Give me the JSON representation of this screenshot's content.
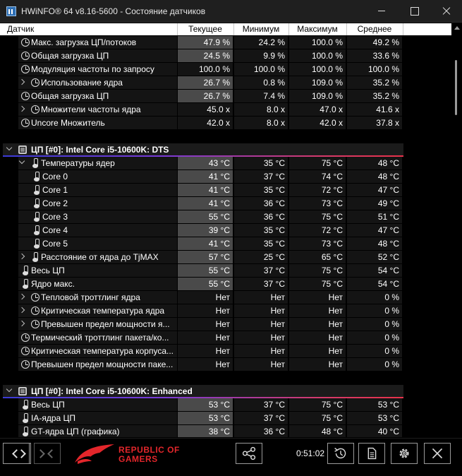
{
  "window": {
    "title": "HWiNFO® 64 v8.16-5600 - Состояние датчиков"
  },
  "columns": {
    "sensor": "Датчик",
    "current": "Текущее",
    "min": "Минимум",
    "max": "Максимум",
    "avg": "Среднее"
  },
  "rows": [
    {
      "kind": "item",
      "indent": 1,
      "expand": "",
      "icon": "clock-icon",
      "name": "Макс. загрузка ЦП/потоков",
      "cur": "47.9 %",
      "min": "24.2 %",
      "max": "100.0 %",
      "avg": "49.2 %",
      "hl": true
    },
    {
      "kind": "item",
      "indent": 1,
      "expand": "",
      "icon": "clock-icon",
      "name": "Общая загрузка ЦП",
      "cur": "24.5 %",
      "min": "9.9 %",
      "max": "100.0 %",
      "avg": "33.6 %",
      "hl": true
    },
    {
      "kind": "item",
      "indent": 1,
      "expand": "",
      "icon": "clock-icon",
      "name": "Модуляция частоты по запросу",
      "cur": "100.0 %",
      "min": "100.0 %",
      "max": "100.0 %",
      "avg": "100.0 %",
      "hl": false
    },
    {
      "kind": "item",
      "indent": 2,
      "expand": "right",
      "icon": "clock-icon",
      "name": "Использование ядра",
      "cur": "26.7 %",
      "min": "0.8 %",
      "max": "109.0 %",
      "avg": "35.2 %",
      "hl": true
    },
    {
      "kind": "item",
      "indent": 1,
      "expand": "",
      "icon": "clock-icon",
      "name": "Общая загрузка ЦП",
      "cur": "26.7 %",
      "min": "7.4 %",
      "max": "109.0 %",
      "avg": "35.2 %",
      "hl": true
    },
    {
      "kind": "item",
      "indent": 2,
      "expand": "right",
      "icon": "clock-icon",
      "name": "Множители частоты ядра",
      "cur": "45.0 x",
      "min": "8.0 x",
      "max": "47.0 x",
      "avg": "41.6 x",
      "hl": false
    },
    {
      "kind": "item",
      "indent": 1,
      "expand": "",
      "icon": "clock-icon",
      "name": "Uncore Множитель",
      "cur": "42.0 x",
      "min": "8.0 x",
      "max": "42.0 x",
      "avg": "37.8 x",
      "hl": false
    },
    {
      "kind": "blank"
    },
    {
      "kind": "group",
      "name": "ЦП [#0]: Intel Core i5-10600K: DTS"
    },
    {
      "kind": "item",
      "indent": 2,
      "expand": "down",
      "icon": "thermometer-icon",
      "name": "Температуры ядер",
      "cur": "43 °C",
      "min": "35 °C",
      "max": "75 °C",
      "avg": "48 °C",
      "hl": true
    },
    {
      "kind": "item",
      "indent": 3,
      "expand": "",
      "icon": "thermometer-icon",
      "name": "Core 0",
      "cur": "41 °C",
      "min": "37 °C",
      "max": "74 °C",
      "avg": "48 °C",
      "hl": true
    },
    {
      "kind": "item",
      "indent": 3,
      "expand": "",
      "icon": "thermometer-icon",
      "name": "Core 1",
      "cur": "41 °C",
      "min": "35 °C",
      "max": "72 °C",
      "avg": "47 °C",
      "hl": true
    },
    {
      "kind": "item",
      "indent": 3,
      "expand": "",
      "icon": "thermometer-icon",
      "name": "Core 2",
      "cur": "41 °C",
      "min": "36 °C",
      "max": "73 °C",
      "avg": "49 °C",
      "hl": true
    },
    {
      "kind": "item",
      "indent": 3,
      "expand": "",
      "icon": "thermometer-icon",
      "name": "Core 3",
      "cur": "55 °C",
      "min": "36 °C",
      "max": "75 °C",
      "avg": "51 °C",
      "hl": true
    },
    {
      "kind": "item",
      "indent": 3,
      "expand": "",
      "icon": "thermometer-icon",
      "name": "Core 4",
      "cur": "39 °C",
      "min": "35 °C",
      "max": "72 °C",
      "avg": "47 °C",
      "hl": true
    },
    {
      "kind": "item",
      "indent": 3,
      "expand": "",
      "icon": "thermometer-icon",
      "name": "Core 5",
      "cur": "41 °C",
      "min": "35 °C",
      "max": "73 °C",
      "avg": "48 °C",
      "hl": true
    },
    {
      "kind": "item",
      "indent": 2,
      "expand": "right",
      "icon": "thermometer-icon",
      "name": "Расстояние от ядра до TjMAX",
      "cur": "57 °C",
      "min": "25 °C",
      "max": "65 °C",
      "avg": "52 °C",
      "hl": true
    },
    {
      "kind": "item",
      "indent": 1,
      "expand": "",
      "icon": "thermometer-icon",
      "name": "Весь ЦП",
      "cur": "55 °C",
      "min": "37 °C",
      "max": "75 °C",
      "avg": "54 °C",
      "hl": true
    },
    {
      "kind": "item",
      "indent": 1,
      "expand": "",
      "icon": "thermometer-icon",
      "name": "Ядро макс.",
      "cur": "55 °C",
      "min": "37 °C",
      "max": "75 °C",
      "avg": "54 °C",
      "hl": true
    },
    {
      "kind": "item",
      "indent": 2,
      "expand": "right",
      "icon": "clock-icon",
      "name": "Тепловой троттлинг ядра",
      "cur": "Нет",
      "min": "Нет",
      "max": "Нет",
      "avg": "0 %",
      "hl": false
    },
    {
      "kind": "item",
      "indent": 2,
      "expand": "right",
      "icon": "clock-icon",
      "name": "Критическая температура ядра",
      "cur": "Нет",
      "min": "Нет",
      "max": "Нет",
      "avg": "0 %",
      "hl": false
    },
    {
      "kind": "item",
      "indent": 2,
      "expand": "right",
      "icon": "clock-icon",
      "name": "Превышен предел мощности я...",
      "cur": "Нет",
      "min": "Нет",
      "max": "Нет",
      "avg": "0 %",
      "hl": false
    },
    {
      "kind": "item",
      "indent": 1,
      "expand": "",
      "icon": "clock-icon",
      "name": "Термический троттлинг пакета/ко...",
      "cur": "Нет",
      "min": "Нет",
      "max": "Нет",
      "avg": "0 %",
      "hl": false
    },
    {
      "kind": "item",
      "indent": 1,
      "expand": "",
      "icon": "clock-icon",
      "name": "Критическая температура корпуса...",
      "cur": "Нет",
      "min": "Нет",
      "max": "Нет",
      "avg": "0 %",
      "hl": false
    },
    {
      "kind": "item",
      "indent": 1,
      "expand": "",
      "icon": "clock-icon",
      "name": "Превышен предел мощности паке...",
      "cur": "Нет",
      "min": "Нет",
      "max": "Нет",
      "avg": "0 %",
      "hl": false
    },
    {
      "kind": "blank"
    },
    {
      "kind": "group",
      "name": "ЦП [#0]: Intel Core i5-10600K: Enhanced"
    },
    {
      "kind": "item",
      "indent": 1,
      "expand": "",
      "icon": "thermometer-icon",
      "name": "Весь ЦП",
      "cur": "53 °C",
      "min": "37 °C",
      "max": "75 °C",
      "avg": "53 °C",
      "hl": true
    },
    {
      "kind": "item",
      "indent": 1,
      "expand": "",
      "icon": "thermometer-icon",
      "name": "IA-ядра ЦП",
      "cur": "53 °C",
      "min": "37 °C",
      "max": "75 °C",
      "avg": "53 °C",
      "hl": true
    },
    {
      "kind": "item",
      "indent": 1,
      "expand": "",
      "icon": "thermometer-icon",
      "name": "GT-ядра ЦП (графика)",
      "cur": "38 °C",
      "min": "36 °C",
      "max": "48 °C",
      "avg": "40 °C",
      "hl": true
    }
  ],
  "bottom": {
    "timer": "0:51:02",
    "brand_line1": "REPUBLIC OF",
    "brand_line2": "GAMERS"
  },
  "colors": {
    "highlight": "#4a4a4a",
    "rowbg": "#141414",
    "brand": "#e3262b"
  }
}
